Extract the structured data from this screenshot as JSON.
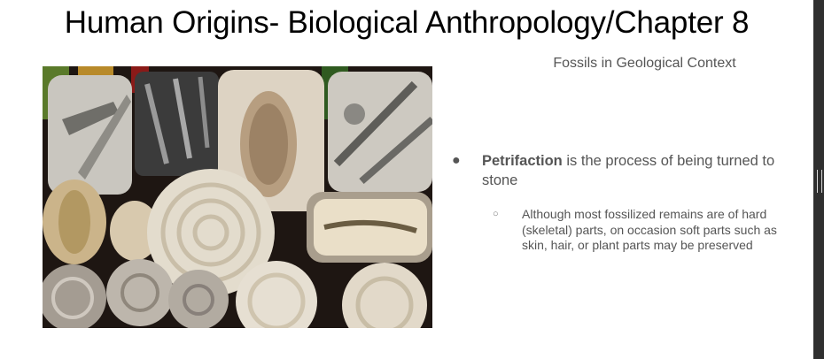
{
  "slide": {
    "title": "Human Origins- Biological Anthropology/Chapter 8",
    "subtitle": "Fossils in Geological Context",
    "bullet": {
      "term": "Petrifaction",
      "text": " is the process of being turned to stone",
      "sub": "Although most fossilized remains are of hard (skeletal) parts, on occasion soft parts such as skin, hair, or plant parts may be preserved"
    },
    "image": {
      "subject": "assorted fossils: ammonites, orthoceras, trilobites"
    }
  }
}
